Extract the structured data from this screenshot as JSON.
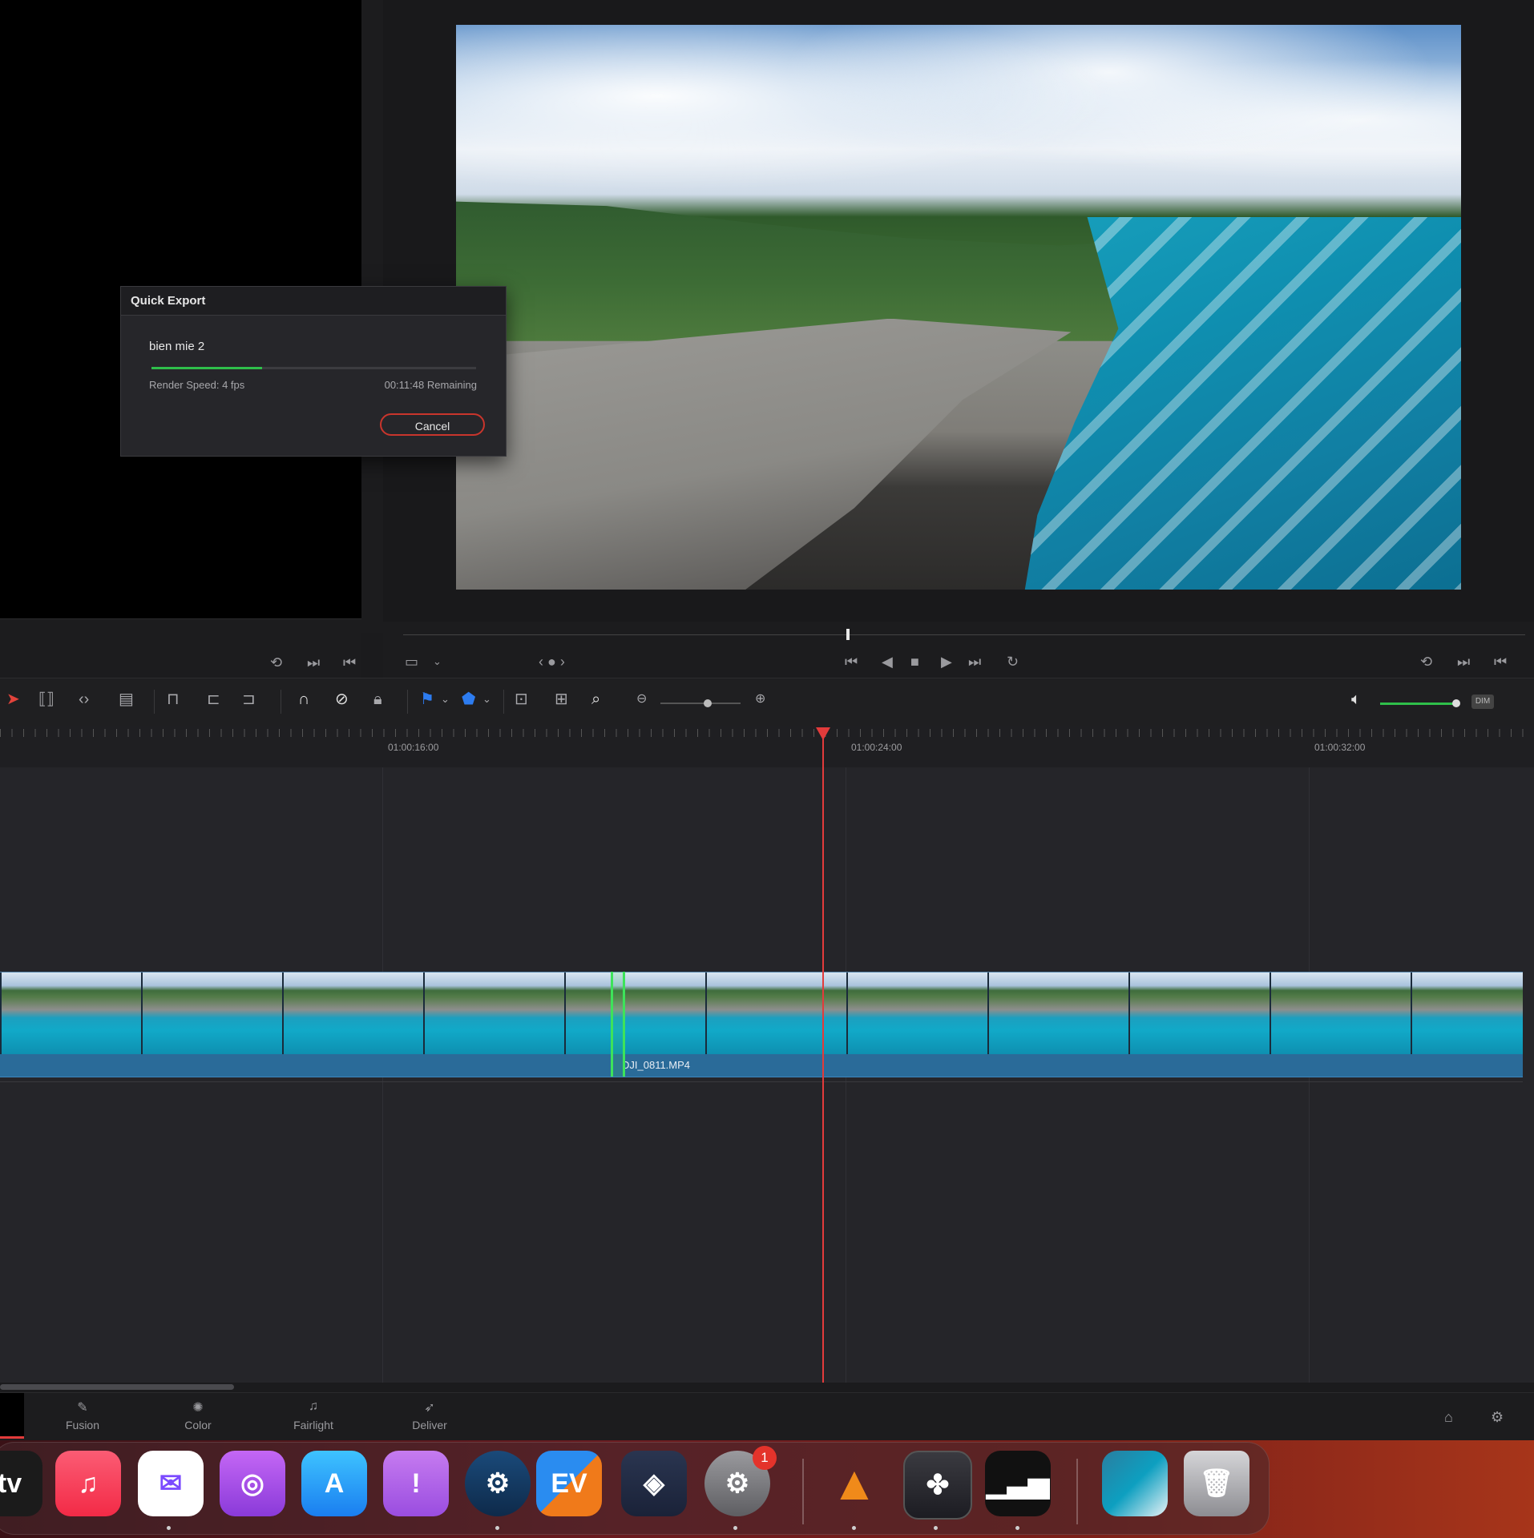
{
  "quick_export": {
    "title": "Quick Export",
    "file_name": "bien mie 2",
    "render_speed": "Render Speed: 4 fps",
    "remaining": "00:11:48 Remaining",
    "cancel": "Cancel",
    "progress": 0.34
  },
  "timeline": {
    "timecodes": [
      "01:00:16:00",
      "01:00:24:00",
      "01:00:32:00"
    ],
    "clip_name": "DJI_0811.MP4",
    "audio_badge": "DIM"
  },
  "pages": [
    "Fusion",
    "Color",
    "Fairlight",
    "Deliver"
  ],
  "dock": {
    "partial_label": "tv",
    "settings_badge": "1"
  },
  "colors": {
    "playhead": "#e23b3b",
    "clip": "#2a6b99",
    "progress": "#2fbf4a",
    "cancel_border": "#c9352c"
  }
}
